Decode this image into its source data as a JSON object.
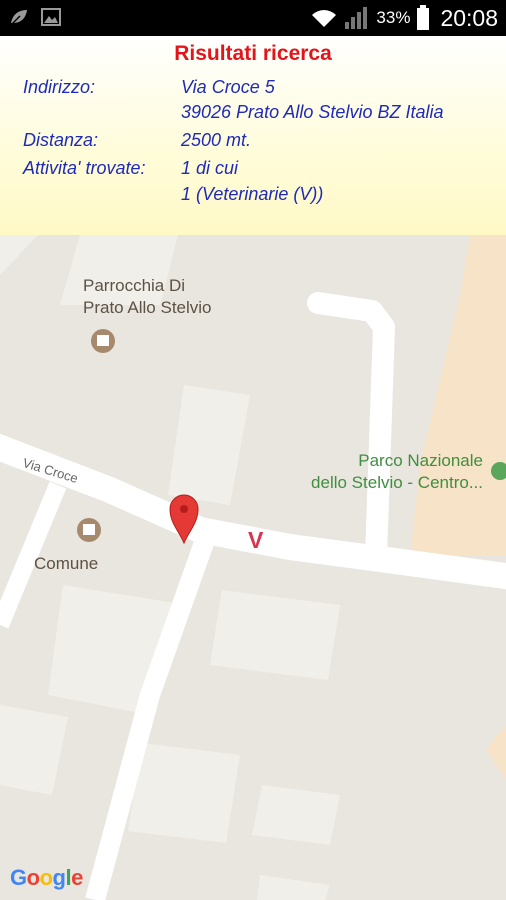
{
  "status": {
    "battery_percent": "33%",
    "time": "20:08"
  },
  "results": {
    "title": "Risultati ricerca",
    "address_label": "Indirizzo:",
    "address_line1": "Via Croce  5",
    "address_line2": "39026 Prato Allo Stelvio BZ  Italia",
    "distance_label": "Distanza:",
    "distance_value": "2500 mt.",
    "activities_label": "Attivita' trovate:",
    "activities_line1": "1 di cui",
    "activities_line2": "1 (Veterinarie (V))"
  },
  "map": {
    "church_label_line1": "Parrocchia Di",
    "church_label_line2": "Prato Allo Stelvio",
    "park_label_line1": "Parco Nazionale",
    "park_label_line2": "dello Stelvio - Centro...",
    "street_label": "Via Croce",
    "town_hall_label": "Comune",
    "vet_marker": "V",
    "google_logo": "Google",
    "colors": {
      "pin": "#e53935",
      "vet_marker": "#d6364f",
      "park_text": "#3f8f3f"
    }
  }
}
